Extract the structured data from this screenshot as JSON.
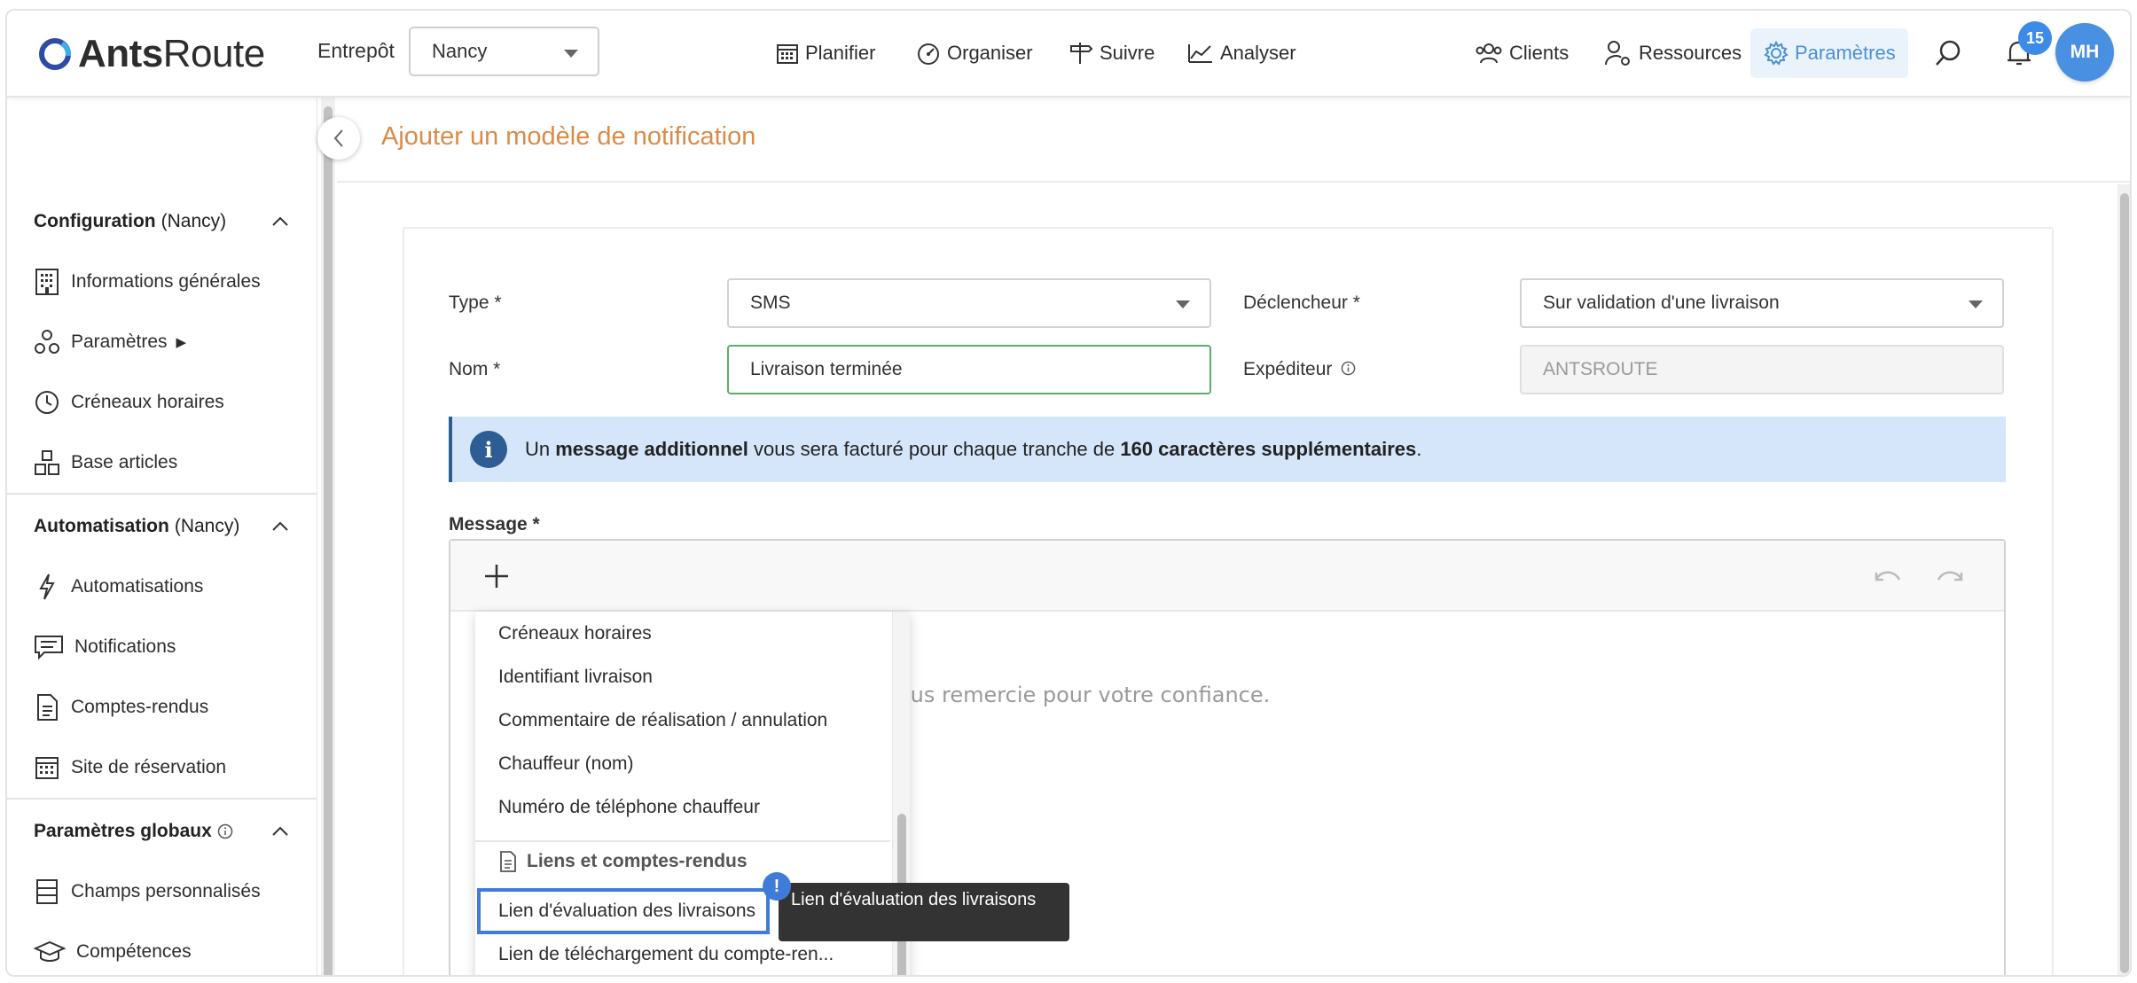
{
  "app": {
    "logo_bold": "Ants",
    "logo_light": "Route"
  },
  "header": {
    "warehouse_label": "Entrepôt",
    "warehouse_value": "Nancy",
    "nav": {
      "plan": "Planifier",
      "organize": "Organiser",
      "track": "Suivre",
      "analyze": "Analyser",
      "clients": "Clients",
      "resources": "Ressources",
      "settings": "Paramètres"
    },
    "notification_count": "15",
    "avatar_initials": "MH",
    "accent_color": "#4a90d9"
  },
  "sidebar": {
    "config_title": "Configuration",
    "config_scope": "(Nancy)",
    "config_items": {
      "general": "Informations générales",
      "params": "Paramètres",
      "params_arrow": "▶",
      "slots": "Créneaux horaires",
      "articles": "Base articles"
    },
    "auto_title": "Automatisation",
    "auto_scope": "(Nancy)",
    "auto_items": {
      "automations": "Automatisations",
      "notifications": "Notifications",
      "reports": "Comptes-rendus",
      "booking": "Site de réservation"
    },
    "global_title": "Paramètres globaux",
    "global_items": {
      "custom_fields": "Champs personnalisés",
      "skills": "Compétences"
    }
  },
  "page": {
    "title": "Ajouter un modèle de notification",
    "title_color": "#d98b4a"
  },
  "form": {
    "type_label": "Type *",
    "type_value": "SMS",
    "trigger_label": "Déclencheur *",
    "trigger_value": "Sur validation d'une livraison",
    "name_label": "Nom *",
    "name_value": "Livraison terminée",
    "sender_label": "Expéditeur",
    "sender_value": "ANTSROUTE",
    "info": {
      "icon": "i",
      "part1": "Un ",
      "bold1": "message additionnel",
      "part2": " vous sera facturé pour chaque tranche de ",
      "bold2": "160 caractères supplémentaires",
      "part3": "."
    },
    "message_label": "Message *",
    "message_preview": "ous remercie pour votre confiance."
  },
  "dropdown": {
    "items": [
      "Créneaux horaires",
      "Identifiant livraison",
      "Commentaire de réalisation / annulation",
      "Chauffeur (nom)",
      "Numéro de téléphone chauffeur"
    ],
    "group_title": "Liens et comptes-rendus",
    "link_items": [
      "Lien d'évaluation des livraisons",
      "Lien de téléchargement du compte-ren..."
    ]
  },
  "tooltip": {
    "badge": "!",
    "text": "Lien d'évaluation des livraisons"
  }
}
